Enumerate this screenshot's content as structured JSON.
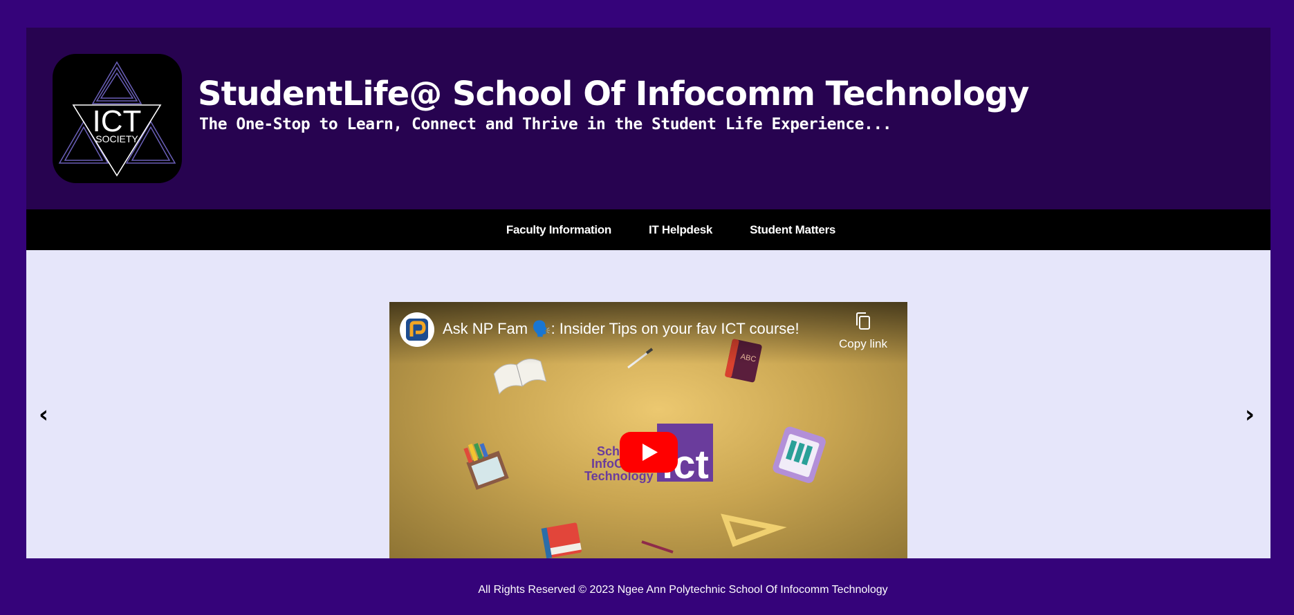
{
  "header": {
    "title": "StudentLife@ School Of Infocomm Technology",
    "tagline": "The One-Stop to Learn, Connect and Thrive in the Student Life Experience...",
    "logo": {
      "line1": "ICT",
      "line2": "SOCIETY"
    }
  },
  "nav": {
    "items": [
      {
        "label": "Faculty Information"
      },
      {
        "label": "IT Helpdesk"
      },
      {
        "label": "Student Matters"
      }
    ]
  },
  "carousel": {
    "prev_label": "‹",
    "next_label": "›"
  },
  "video": {
    "title": "Ask NP Fam 🗣️: Insider Tips on your fav ICT course!",
    "copy_link_label": "Copy link",
    "thumbnail_text": {
      "school": "School of Infocomm Technology",
      "badge": "ict"
    }
  },
  "footer": {
    "text": "All Rights Reserved © 2023 Ngee Ann Polytechnic School Of Infocomm Technology"
  },
  "colors": {
    "page_bg": "#35037a",
    "header_bg": "#270350",
    "nav_bg": "#000000",
    "content_bg": "#e6e6fa",
    "play_button": "#ff0000"
  }
}
